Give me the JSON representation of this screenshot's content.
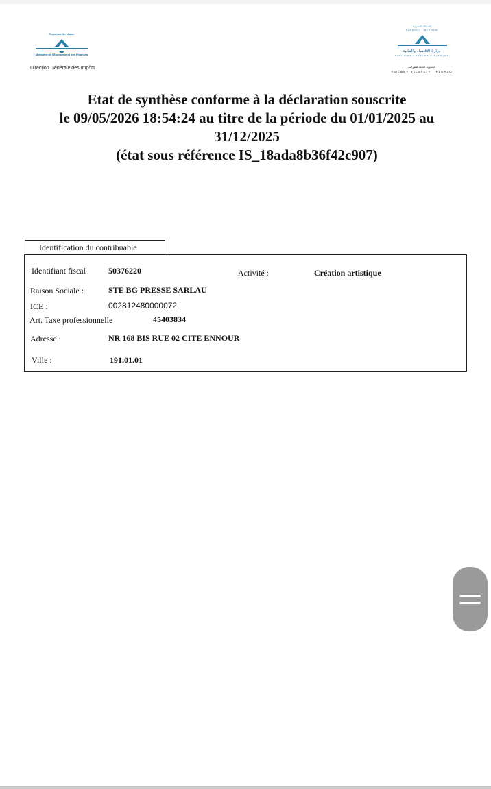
{
  "header": {
    "left_logo": {
      "kingdom": "Royaume du Maroc",
      "ministry": "Ministère de l'Économie et des Finances",
      "dgi": "Direction Générale des Impôts"
    },
    "right_logo": {
      "line1": "المملكة المغربية",
      "line2": "ⵜⴰⴳⵍⴷⵉⵜ ⵏ ⵍⵎⵖⵔⵉⴱ",
      "line3": "وزارة الاقتصاد والمالية",
      "line4": "ⵜⴰⵎⴰⵡⴰⵙⵜ ⵏ ⵜⴷⵎⴰⵙⵜ ⴷ ⵜⴰⵢⵔⴰⵡⵜ",
      "line5": "المديرية العامة للضرائب",
      "line6": "ⵜⴰⵏⵎⵀⵍⵜ ⵜⴰⵎⴰⵜⴰⵢⵜ ⵏ ⵜⵉⵙⵖⴰⵔ"
    }
  },
  "title": {
    "line1": "Etat de synthèse conforme à la déclaration souscrite",
    "line2": "le 09/05/2026 18:54:24 au titre de la période du 01/01/2025 au",
    "line3": "31/12/2025",
    "line4": "(état sous référence IS_18ada8b36f42c907)"
  },
  "identification": {
    "tab_label": "Identification du contribuable",
    "identifiant_fiscal_label": "Identifiant fiscal",
    "identifiant_fiscal": "50376220",
    "activite_label": "Activité :",
    "activite": "Création artistique",
    "raison_sociale_label": "Raison Sociale :",
    "raison_sociale": "STE BG PRESSE SARLAU",
    "ice_label": "ICE :",
    "ice": "002812480000072",
    "taxe_pro_label": "Art. Taxe professionnelle",
    "taxe_pro": "45403834",
    "adresse_label": "Adresse :",
    "adresse": "NR 168 BIS RUE 02 CITE ENNOUR",
    "ville_label": "Ville :",
    "ville": "191.01.01"
  },
  "colors": {
    "logo_blue": "#2a7fa8",
    "scroll_handle": "#9a9a9a"
  },
  "icons": {
    "scroll": "drag-handle-icon"
  }
}
